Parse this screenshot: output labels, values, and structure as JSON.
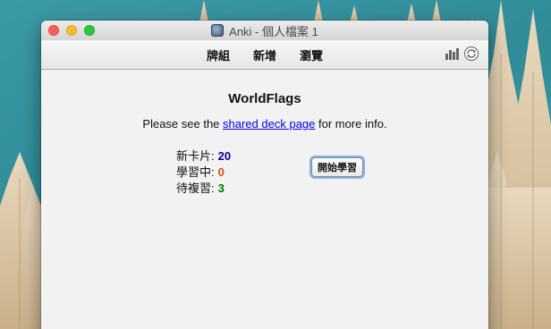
{
  "window": {
    "title": "Anki - 個人檔案 1"
  },
  "toolbar": {
    "decks_label": "牌組",
    "add_label": "新增",
    "browse_label": "瀏覽",
    "right_icons": [
      "stats-icon",
      "sync-icon"
    ]
  },
  "deck": {
    "title": "WorldFlags",
    "info_prefix": "Please see the ",
    "info_link": "shared deck page",
    "info_suffix": " for more info."
  },
  "counts": {
    "new_label": "新卡片:",
    "new_value": "20",
    "learning_label": "學習中:",
    "learning_value": "0",
    "review_label": "待複習:",
    "review_value": "3"
  },
  "study_button": {
    "label": "開始學習"
  },
  "colors": {
    "new": "#000099",
    "learning": "#c35617",
    "review": "#007700",
    "link": "#0000ee",
    "focus_ring": "#7fb4ee"
  }
}
